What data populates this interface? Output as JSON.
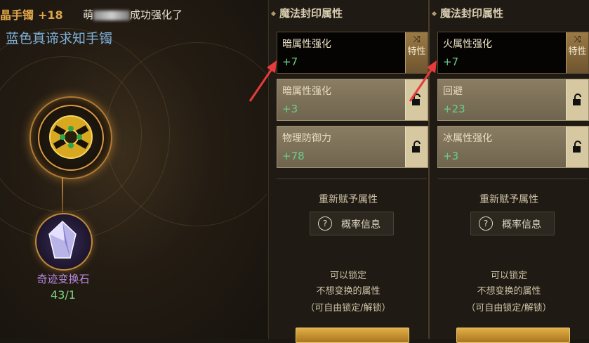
{
  "item": {
    "partial_name": "晶手镯",
    "upgrade_level": "+18",
    "notice_prefix": "萌",
    "notice_suffix": "成功强化了",
    "title": "蓝色真谛求知手镯"
  },
  "material": {
    "name": "奇迹变换石",
    "count": "43/1"
  },
  "panels": [
    {
      "title": "魔法封印属性",
      "slots": [
        {
          "name": "暗属性强化",
          "value": "+7",
          "state": "active",
          "side_label": "特性"
        },
        {
          "name": "暗属性强化",
          "value": "+3",
          "state": "locked"
        },
        {
          "name": "物理防御力",
          "value": "+78",
          "state": "locked"
        }
      ],
      "reassign_label": "重新赋予属性",
      "prob_button_label": "概率信息",
      "info_lines": [
        "可以锁定",
        "不想变换的属性",
        "（可自由锁定/解锁）"
      ]
    },
    {
      "title": "魔法封印属性",
      "slots": [
        {
          "name": "火属性强化",
          "value": "+7",
          "state": "active",
          "side_label": "特性"
        },
        {
          "name": "回避",
          "value": "+23",
          "state": "locked"
        },
        {
          "name": "冰属性强化",
          "value": "+3",
          "state": "locked"
        }
      ],
      "reassign_label": "重新赋予属性",
      "prob_button_label": "概率信息",
      "info_lines": [
        "可以锁定",
        "不想变换的属性",
        "（可自由锁定/解锁）"
      ]
    }
  ],
  "colors": {
    "value_green": "#69d08a",
    "title_blue": "#7fb0d8",
    "accent_gold": "#e0a64a",
    "stone_purple": "#b98ae0",
    "annotation_red": "#e83b3b"
  },
  "icons": {
    "shuffle": "shuffle-icon",
    "lock": "unlocked-padlock-icon",
    "question": "question-icon"
  }
}
